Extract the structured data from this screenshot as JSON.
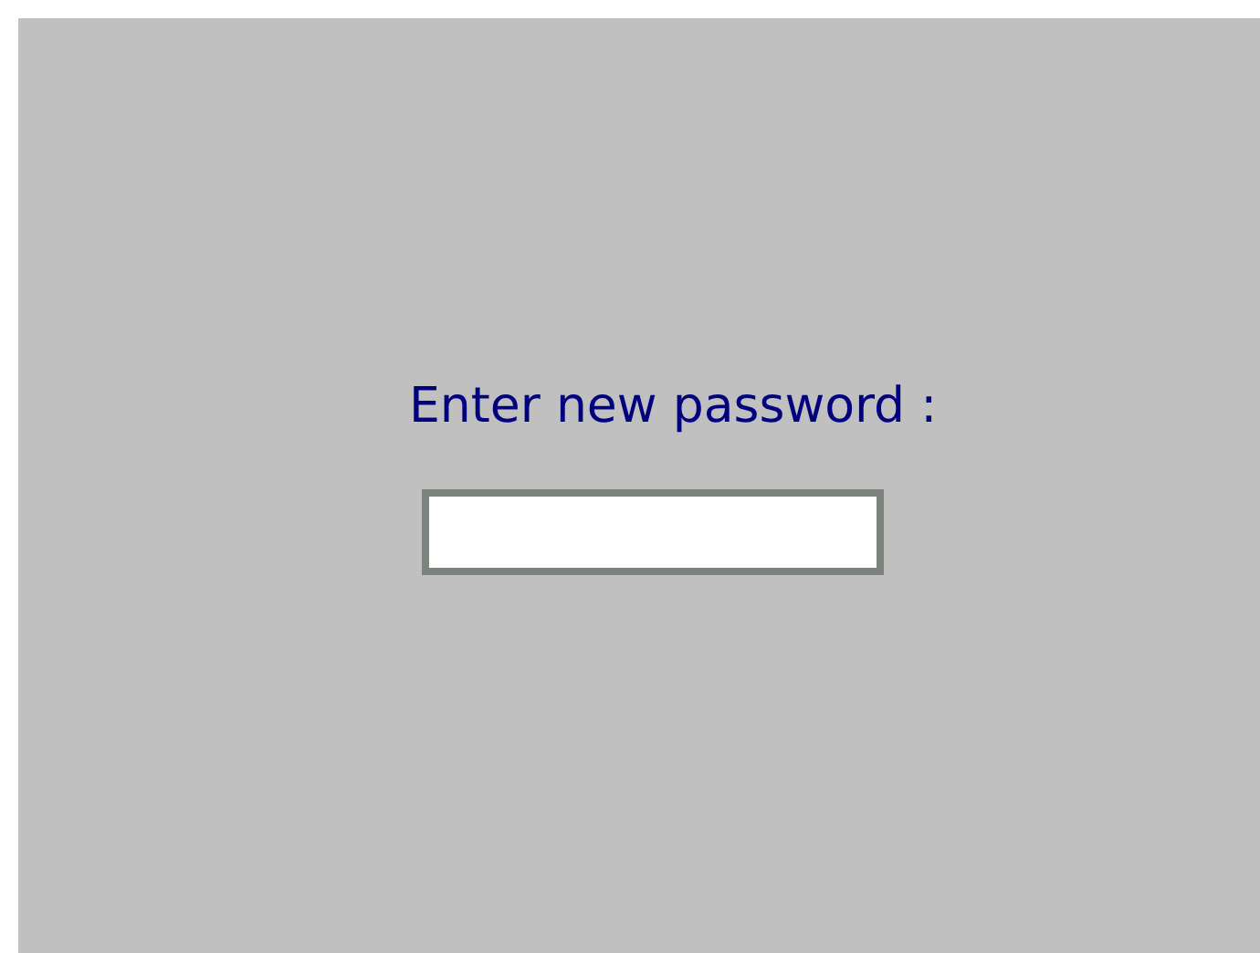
{
  "prompt": {
    "label": "Enter new password :"
  }
}
